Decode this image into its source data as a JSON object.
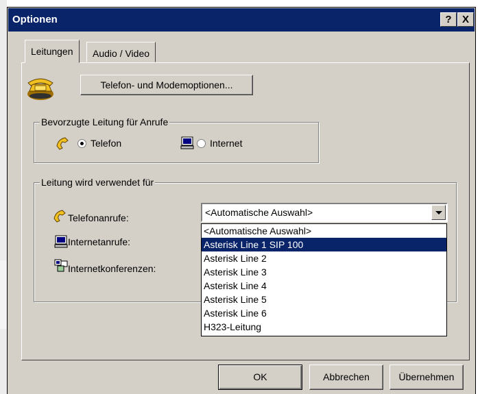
{
  "window": {
    "title": "Optionen",
    "help_button": "?",
    "close_button": "X"
  },
  "tabs": [
    {
      "label": "Leitungen",
      "active": true
    },
    {
      "label": "Audio / Video",
      "active": false
    }
  ],
  "phone_modem_button": "Telefon- und Modemoptionen...",
  "preferred_group": {
    "legend": "Bevorzugte Leitung für Anrufe",
    "options": [
      {
        "label": "Telefon",
        "selected": true
      },
      {
        "label": "Internet",
        "selected": false
      }
    ]
  },
  "usage_group": {
    "legend": "Leitung wird verwendet für",
    "rows": [
      {
        "label": "Telefonanrufe:"
      },
      {
        "label": "Internetanrufe:"
      },
      {
        "label": "Internetkonferenzen:"
      }
    ],
    "combo_value": "<Automatische Auswahl>",
    "dropdown_options": [
      "<Automatische Auswahl>",
      "Asterisk Line 1  SIP 100",
      "Asterisk Line 2",
      "Asterisk Line 3",
      "Asterisk Line 4",
      "Asterisk Line 5",
      "Asterisk Line 6",
      "H323-Leitung"
    ],
    "highlighted_index": 1
  },
  "buttons": {
    "ok": "OK",
    "cancel": "Abbrechen",
    "apply": "Übernehmen"
  },
  "colors": {
    "titlebar": "#0a246a",
    "face": "#d4d0c8",
    "selection": "#0a246a"
  }
}
